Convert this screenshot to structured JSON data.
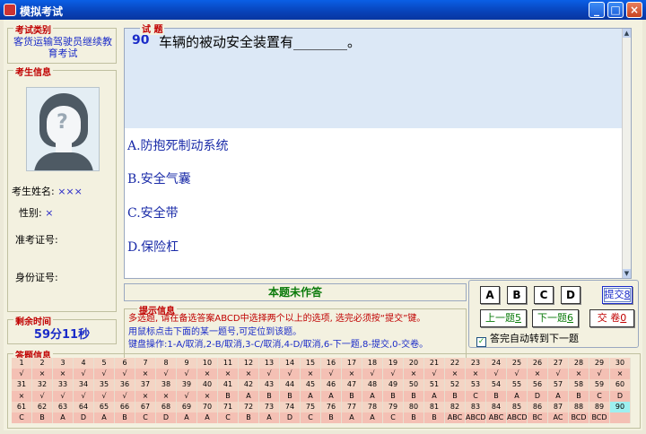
{
  "window": {
    "title": "模拟考试"
  },
  "left": {
    "exam_type_label": "考试类别",
    "exam_type_value": "客货运输驾驶员继续教育考试",
    "student_label": "考生信息",
    "name_label": "考生姓名:",
    "name_value": "×××",
    "gender_label": "性别:",
    "gender_value": "×",
    "ticket_label": "准考证号:",
    "id_label": "身份证号:",
    "remain_label": "剩余时间",
    "remain_value": "59分11秒"
  },
  "question": {
    "label": "试 题",
    "number": "90",
    "text": "车辆的被动安全装置有________。",
    "options": [
      "A.防抱死制动系统",
      "B.安全气囊",
      "C.安全带",
      "D.保险杠"
    ]
  },
  "status": "本题未作答",
  "tips": {
    "label": "提示信息",
    "line1": "多选题, 请在备选答案ABCD中选择两个以上的选项, 选完必须按“提交”键。",
    "line2": "用鼠标点击下面的某一题号,可定位到该题。",
    "line3": "键盘操作:1-A/取消,2-B/取消,3-C/取消,4-D/取消,6-下一题,8-提交,0-交卷。"
  },
  "buttons": {
    "a": "A",
    "b": "B",
    "c": "C",
    "d": "D",
    "submit": "提交",
    "submit_key": "8",
    "prev": "上一题",
    "prev_key": "5",
    "next": "下一题",
    "next_key": "6",
    "handin": "交 卷",
    "handin_key": "0",
    "auto_next": "答完自动转到下一题"
  },
  "answers_label": "答题信息",
  "answer_rows": [
    {
      "nums": [
        "1",
        "2",
        "3",
        "4",
        "5",
        "6",
        "7",
        "8",
        "9",
        "10",
        "11",
        "12",
        "13",
        "14",
        "15",
        "16",
        "17",
        "18",
        "19",
        "20",
        "21",
        "22",
        "23",
        "24",
        "25",
        "26",
        "27",
        "28",
        "29",
        "30"
      ],
      "vals": [
        "√",
        "×",
        "×",
        "√",
        "√",
        "√",
        "×",
        "√",
        "√",
        "×",
        "×",
        "×",
        "√",
        "√",
        "×",
        "√",
        "×",
        "√",
        "√",
        "×",
        "√",
        "×",
        "×",
        "√",
        "√",
        "×",
        "√",
        "×",
        "√",
        "×"
      ]
    },
    {
      "nums": [
        "31",
        "32",
        "33",
        "34",
        "35",
        "36",
        "37",
        "38",
        "39",
        "40",
        "41",
        "42",
        "43",
        "44",
        "45",
        "46",
        "47",
        "48",
        "49",
        "50",
        "51",
        "52",
        "53",
        "54",
        "55",
        "56",
        "57",
        "58",
        "59",
        "60"
      ],
      "vals": [
        "×",
        "√",
        "√",
        "√",
        "√",
        "√",
        "×",
        "×",
        "√",
        "×",
        "B",
        "A",
        "B",
        "B",
        "A",
        "A",
        "B",
        "A",
        "B",
        "B",
        "A",
        "B",
        "C",
        "B",
        "A",
        "D",
        "A",
        "B",
        "C",
        "D"
      ]
    },
    {
      "nums": [
        "61",
        "62",
        "63",
        "64",
        "65",
        "66",
        "67",
        "68",
        "69",
        "70",
        "71",
        "72",
        "73",
        "74",
        "75",
        "76",
        "77",
        "78",
        "79",
        "80",
        "81",
        "82",
        "83",
        "84",
        "85",
        "86",
        "87",
        "88",
        "89",
        "90"
      ],
      "vals": [
        "C",
        "B",
        "A",
        "D",
        "A",
        "B",
        "C",
        "D",
        "A",
        "A",
        "C",
        "B",
        "A",
        "D",
        "C",
        "B",
        "A",
        "A",
        "C",
        "B",
        "B",
        "ABC",
        "ABCD",
        "ABC",
        "ABCD",
        "BC",
        "AC",
        "BCD",
        "BCD",
        ""
      ]
    }
  ],
  "current_question_index": 90,
  "colors": {
    "label_red": "#C00000",
    "text_blue": "#1A2BC8",
    "grid_cell": "#F4C0B4",
    "current_cell": "#9EF0F0",
    "title_blue": "#0A5FE6"
  }
}
